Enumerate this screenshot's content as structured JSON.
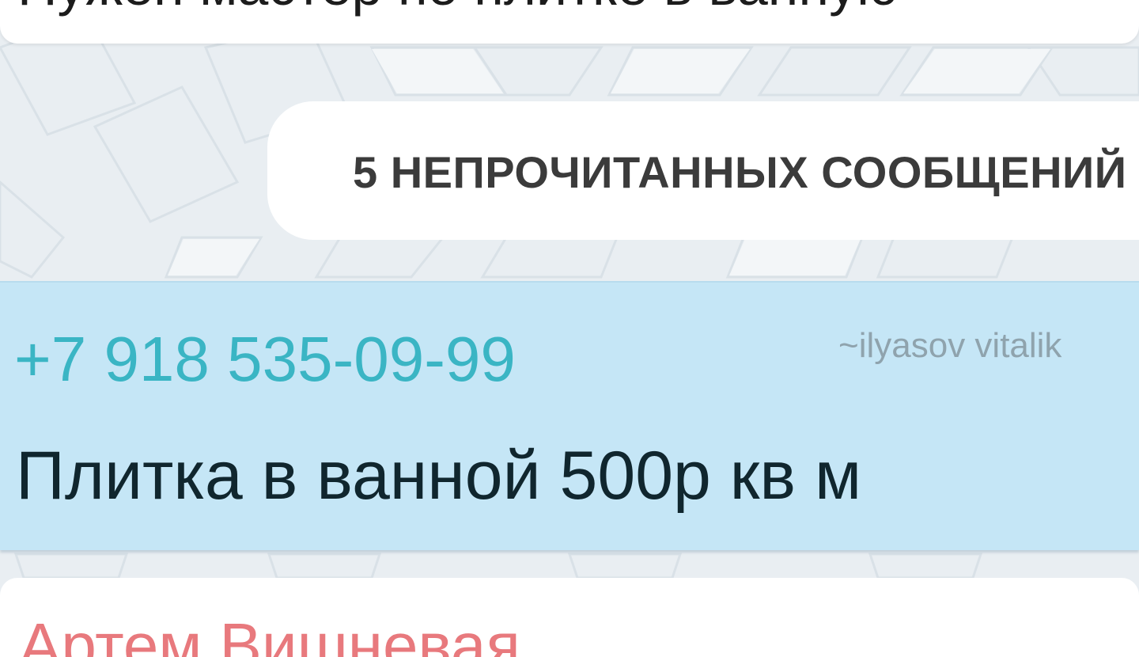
{
  "top_message": {
    "text": "Нужен мастер по плитке в ванную"
  },
  "unread_divider": {
    "label": "5 НЕПРОЧИТАННЫХ СООБЩЕНИЙ"
  },
  "message": {
    "sender_phone": "+7 918 535-09-99",
    "sender_nick": "~ilyasov vitalik",
    "text": "Плитка в ванной 500р кв м"
  },
  "next_message": {
    "sender": "Артем Вишневая"
  },
  "colors": {
    "bubble": "#c5e6f6",
    "phone": "#3ab5c4",
    "next_sender": "#e8797d"
  }
}
